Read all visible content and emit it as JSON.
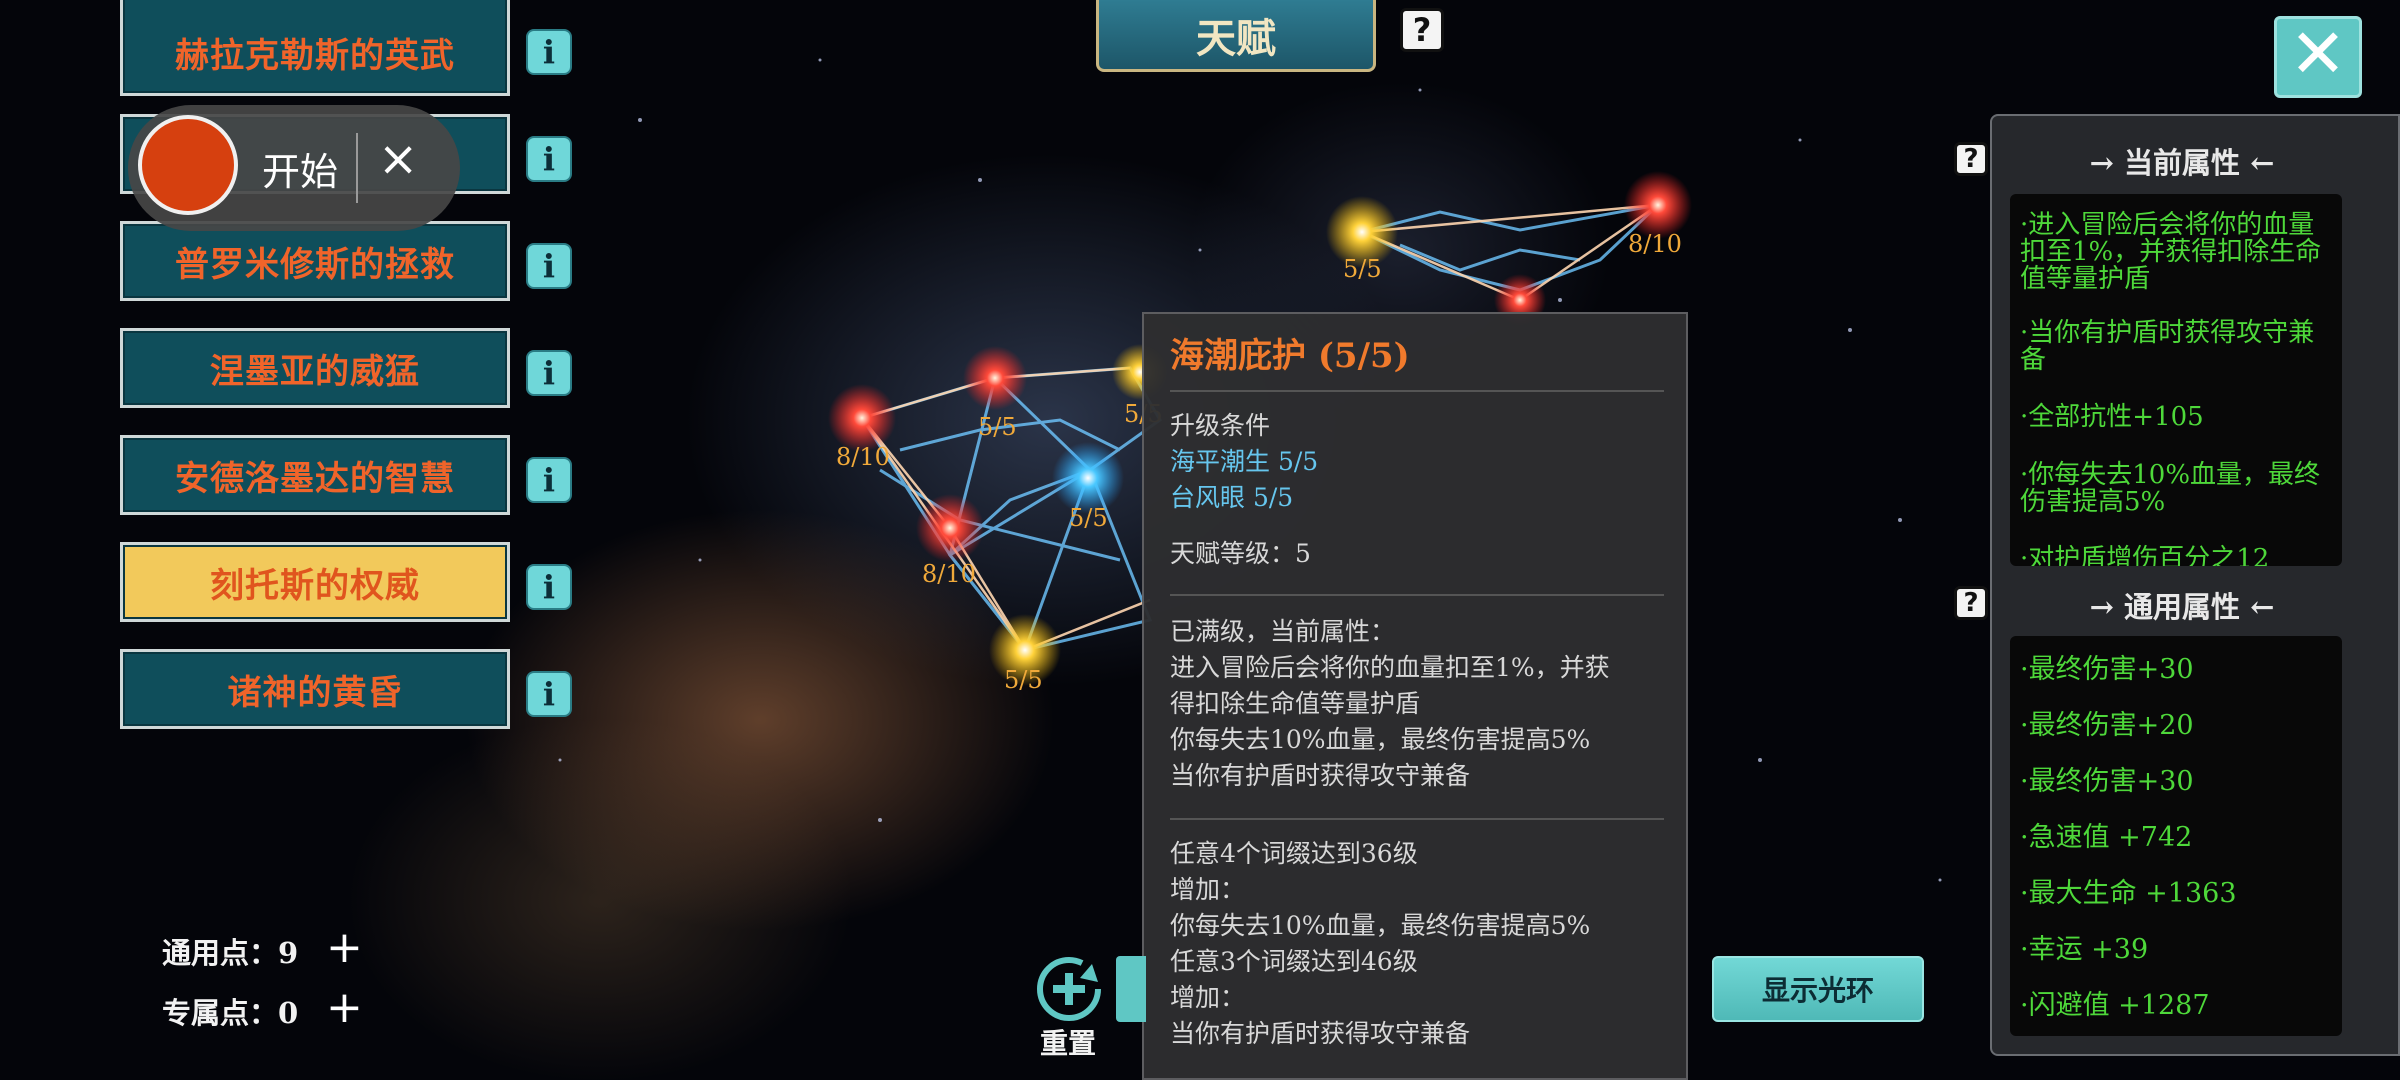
{
  "title_tab": "天赋",
  "constellations": [
    {
      "label": "赫拉克勒斯的英武",
      "selected": false
    },
    {
      "label": "",
      "selected": false
    },
    {
      "label": "普罗米修斯的拯救",
      "selected": false
    },
    {
      "label": "涅墨亚的威猛",
      "selected": false
    },
    {
      "label": "安德洛墨达的智慧",
      "selected": false
    },
    {
      "label": "刻托斯的权威",
      "selected": true
    },
    {
      "label": "诸神的黄昏",
      "selected": false
    }
  ],
  "info_icon": "i",
  "recording": {
    "label": "开始",
    "close": "×"
  },
  "help_glyph": "?",
  "close_glyph": "✕",
  "star_labels": [
    "5/5",
    "8/10",
    "8/10",
    "5/5",
    "5/5",
    "8/10",
    "5/5",
    "5/5"
  ],
  "tooltip": {
    "title": "海潮庇护 (5/5)",
    "upgrade_condition_label": "升级条件",
    "conditions": [
      "海平潮生 5/5",
      "台风眼 5/5"
    ],
    "talent_level": "天赋等级：5",
    "maxed_label": "已满级，当前属性：",
    "current_lines": [
      "进入冒险后会将你的血量扣至1%，并获",
      "得扣除生命值等量护盾",
      "你每失去10%血量，最终伤害提高5%",
      "当你有护盾时获得攻守兼备"
    ],
    "bonus_lines": [
      "任意4个词缀达到36级",
      "增加：",
      "你每失去10%血量，最终伤害提高5%",
      "任意3个词缀达到46级",
      "增加：",
      "当你有护盾时获得攻守兼备"
    ]
  },
  "points": {
    "general_label": "通用点：",
    "general_value": "9",
    "exclusive_label": "专属点：",
    "exclusive_value": "0",
    "plus": "+"
  },
  "reset_label": "重置",
  "show_halo_label": "显示光环",
  "attributes": {
    "current_header": "→  当前属性  ←",
    "current_lines": [
      "·进入冒险后会将你的血量",
      "扣至1%，并获得扣除生命",
      "值等量护盾",
      "·当你有护盾时获得攻守兼",
      "备",
      "·全部抗性+105",
      "·你每失去10%血量，最终",
      "伤害提高5%",
      "·对护盾增伤百分之12"
    ],
    "general_header": "→  通用属性  ←",
    "general_lines": [
      "·最终伤害+30",
      "·最终伤害+20",
      "·最终伤害+30",
      "·急速值 +742",
      "·最大生命 +1363",
      "·幸运 +39",
      "·闪避值 +1287"
    ]
  },
  "colors": {
    "button_teal": "#0f4e5b",
    "selected_gold": "#f2c95b",
    "label_orange": "#f0642a",
    "attr_green": "#4ed83a",
    "condition_blue": "#66c6ee"
  },
  "icons": [
    "info-icon",
    "help-icon",
    "close-icon",
    "plus-icon",
    "reset-plus-icon",
    "record-dot-icon"
  ]
}
